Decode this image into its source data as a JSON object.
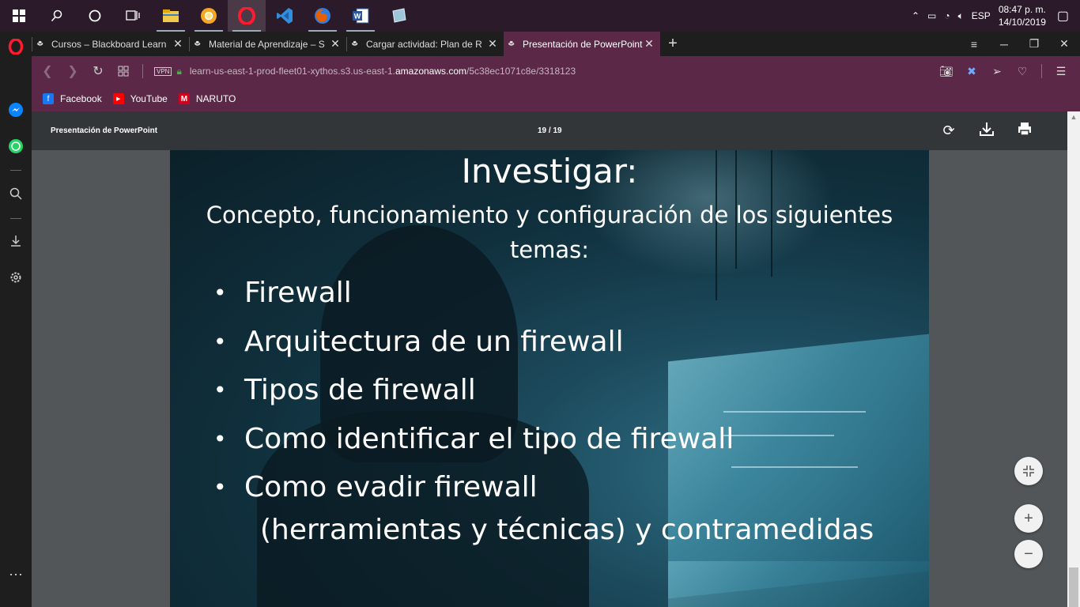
{
  "taskbar": {
    "apps": [
      {
        "name": "windows-start-icon",
        "glyph": "⊞"
      },
      {
        "name": "search-icon",
        "glyph": "⚲"
      },
      {
        "name": "cortana-icon",
        "glyph": "○"
      },
      {
        "name": "task-view-icon",
        "glyph": "⧉"
      },
      {
        "name": "file-explorer-icon",
        "glyph": "▬"
      },
      {
        "name": "chrome-canary-icon",
        "glyph": "●"
      },
      {
        "name": "opera-icon",
        "glyph": "O"
      },
      {
        "name": "vscode-icon",
        "glyph": "❮❯"
      },
      {
        "name": "firefox-icon",
        "glyph": "◉"
      },
      {
        "name": "word-icon",
        "glyph": "W"
      },
      {
        "name": "notes-icon",
        "glyph": "▱"
      }
    ],
    "tray": {
      "language": "ESP",
      "time": "08:47 p. m.",
      "date": "14/10/2019"
    }
  },
  "sidebar": {
    "items": [
      "opera-logo-icon",
      "messenger-icon",
      "whatsapp-icon",
      "search-icon",
      "downloads-icon",
      "settings-icon",
      "more-icon"
    ]
  },
  "tabs": [
    {
      "title": "Cursos – Blackboard Learn",
      "active": false
    },
    {
      "title": "Material de Aprendizaje – S",
      "active": false
    },
    {
      "title": "Cargar actividad: Plan de R",
      "active": false
    },
    {
      "title": "Presentación de PowerPoint",
      "active": true
    }
  ],
  "address": {
    "vpn_label": "VPN",
    "url_prefix": "learn-us-east-1-prod-fleet01-xythos.s3.us-east-1.",
    "url_domain": "amazonaws.com",
    "url_path": "/5c38ec1071c8e/3318123"
  },
  "bookmarks": [
    {
      "label": "Facebook",
      "icon": "facebook-icon",
      "color": "#1877f2",
      "glyph": "f"
    },
    {
      "label": "YouTube",
      "icon": "youtube-icon",
      "color": "#ff0000",
      "glyph": "▶"
    },
    {
      "label": "NARUTO",
      "icon": "naruto-icon",
      "color": "#d0021b",
      "glyph": "M"
    }
  ],
  "pdf": {
    "title": "Presentación de PowerPoint",
    "page_indicator": "19 / 19"
  },
  "slide": {
    "title": "Investigar:",
    "subtitle": "Concepto, funcionamiento y configuración de los siguientes temas:",
    "bullets": [
      "Firewall",
      "Arquitectura de un firewall",
      "Tipos de firewall",
      "Como identificar el tipo de firewall",
      "Como evadir firewall"
    ],
    "continuation": "(herramientas y técnicas) y contramedidas"
  },
  "colors": {
    "tab_active": "#5b2947",
    "address_bar": "#5b2947",
    "pdf_toolbar": "#323639",
    "viewer_bg": "#525659"
  }
}
